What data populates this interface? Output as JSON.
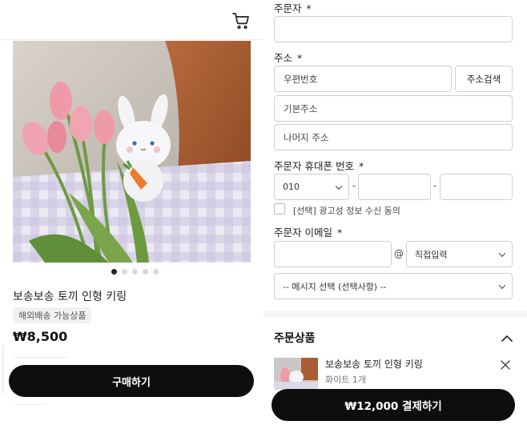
{
  "left": {
    "product_name": "보송보송 토끼 인형 키링",
    "shipping_badge": "해외배송 가능상품",
    "price": "₩8,500",
    "buy_button": "구매하기",
    "carousel_pages": 5,
    "carousel_active": 1,
    "icons": {
      "cart": "cart-icon"
    }
  },
  "form": {
    "orderer_label": "주문자",
    "orderer_value": "",
    "required_mark": "*",
    "address_label": "주소",
    "postal_placeholder": "우편번호",
    "address_search_button": "주소검색",
    "address_basic_placeholder": "기본주소",
    "address_rest_placeholder": "나머지 주소",
    "phone_label": "주문자 휴대폰 번호",
    "phone_prefix": "010",
    "phone_separator": "-",
    "ad_consent_label": "[선택] 광고성 정보 수신 동의",
    "email_label": "주문자 이메일",
    "email_at": "@",
    "email_domain_select": "직접입력",
    "message_select": "-- 메시지 선택 (선택사항) --"
  },
  "order": {
    "section_title": "주문상품",
    "item_name": "보송보송 토끼 인형 키링",
    "item_option": "화이트 1개",
    "pay_button": "₩12,000 결제하기"
  },
  "colors": {
    "primary_button": "#0e0e0e",
    "border": "#cfcfcf"
  }
}
